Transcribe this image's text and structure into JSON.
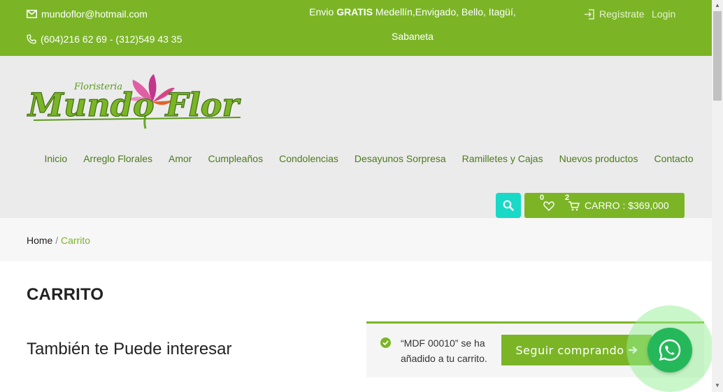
{
  "topbar": {
    "email": "mundoflor@hotmail.com",
    "phone": "(604)216 62 69 - (312)549 43 35",
    "shipping_prefix": "Envio ",
    "shipping_bold": "GRATIS",
    "shipping_line1": " Medellín,Envigado, Bello, Itagüí,",
    "shipping_line2": "Sabaneta",
    "register": "Regístrate",
    "login": "Login"
  },
  "logo": {
    "top": "Floristeria",
    "main": "Mundo Flor"
  },
  "nav": [
    "Inicio",
    "Arreglo Florales",
    "Amor",
    "Cumpleaños",
    "Condolencias",
    "Desayunos Sorpresa",
    "Ramilletes y Cajas",
    "Nuevos productos",
    "Contacto"
  ],
  "cart": {
    "wishlist_count": "0",
    "cart_count": "2",
    "label": "CARRO : $369,000"
  },
  "breadcrumb": {
    "home": "Home",
    "sep": " / ",
    "current": "Carrito"
  },
  "page": {
    "title": "CARRITO",
    "subtitle": "También te Puede interesar"
  },
  "notice": {
    "message": "“MDF 00010” se ha añadido a tu carrito.",
    "button": "Seguir comprando"
  },
  "colors": {
    "brand": "#7bb526",
    "search": "#19d9c7",
    "whatsapp": "#25b85a"
  }
}
